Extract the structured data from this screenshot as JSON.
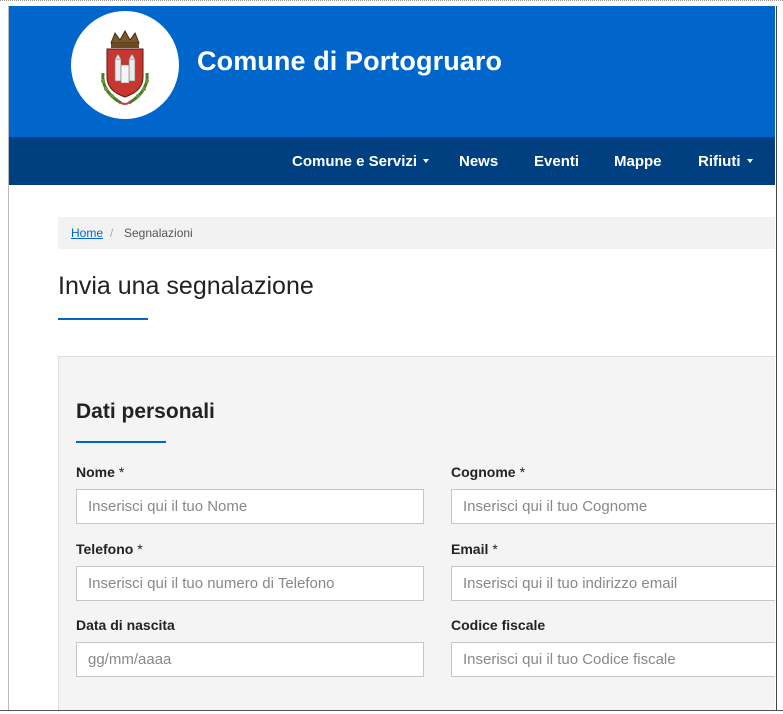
{
  "header": {
    "site_title": "Comune di Portogruaro",
    "brand_color": "#0066cc",
    "nav_color": "#004080"
  },
  "nav": {
    "items": [
      {
        "label": "Comune e Servizi",
        "has_dropdown": true
      },
      {
        "label": "News",
        "has_dropdown": false
      },
      {
        "label": "Eventi",
        "has_dropdown": false
      },
      {
        "label": "Mappe",
        "has_dropdown": false
      },
      {
        "label": "Rifiuti",
        "has_dropdown": true
      }
    ]
  },
  "breadcrumb": {
    "home": "Home",
    "separator": "/",
    "current": "Segnalazioni"
  },
  "page": {
    "title": "Invia una segnalazione"
  },
  "form": {
    "section_title": "Dati personali",
    "fields": {
      "nome": {
        "label": "Nome",
        "required": "*",
        "placeholder": "Inserisci qui il tuo Nome",
        "value": ""
      },
      "cognome": {
        "label": "Cognome",
        "required": "*",
        "placeholder": "Inserisci qui il tuo Cognome",
        "value": ""
      },
      "telefono": {
        "label": "Telefono",
        "required": "*",
        "placeholder": "Inserisci qui il tuo numero di Telefono",
        "value": ""
      },
      "email": {
        "label": "Email",
        "required": "*",
        "placeholder": "Inserisci qui il tuo indirizzo email",
        "value": ""
      },
      "data_nascita": {
        "label": "Data di nascita",
        "placeholder": "gg/mm/aaaa",
        "value": ""
      },
      "codice_fiscale": {
        "label": "Codice fiscale",
        "placeholder": "Inserisci qui il tuo Codice fiscale",
        "value": ""
      }
    }
  }
}
